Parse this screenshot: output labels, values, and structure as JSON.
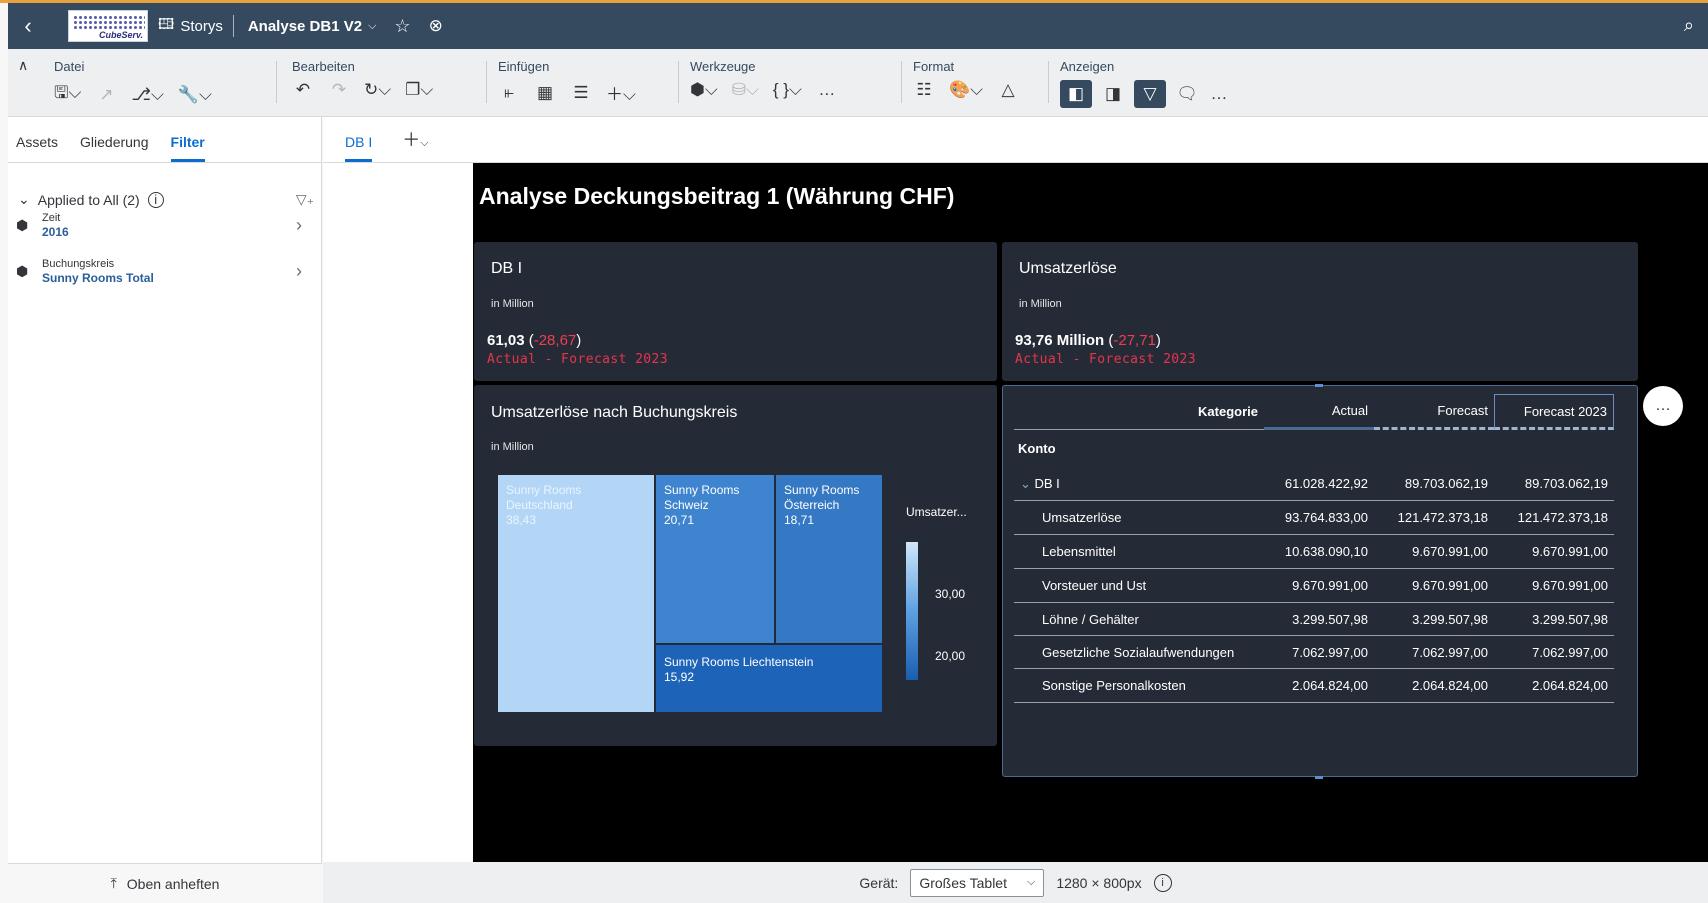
{
  "shell": {
    "logo_text": "CubeServ.",
    "storys_label": "Storys",
    "doc_title": "Analyse DB1 V2"
  },
  "toolbar": {
    "datei": "Datei",
    "bearbeiten": "Bearbeiten",
    "einfuegen": "Einfügen",
    "werkzeuge": "Werkzeuge",
    "format": "Format",
    "anzeigen": "Anzeigen"
  },
  "left": {
    "tabs": [
      "Assets",
      "Gliederung",
      "Filter"
    ],
    "applied": "Applied to All (2)",
    "filters": [
      {
        "label": "Zeit",
        "value": "2016"
      },
      {
        "label": "Buchungskreis",
        "value": "Sunny Rooms Total"
      }
    ],
    "pin_label": "Oben anheften"
  },
  "pagetabs": {
    "tab1": "DB I"
  },
  "story": {
    "title": "Analyse Deckungsbeitrag 1 (Währung CHF)",
    "kpi1": {
      "title": "DB I",
      "subtitle": "in Million",
      "value": "61,03",
      "delta_open": " (",
      "delta": "-28,67",
      "delta_close": ")",
      "label": "Actual - Forecast 2023"
    },
    "kpi2": {
      "title": "Umsatzerlöse",
      "subtitle": "in Million",
      "value": "93,76 Million",
      "delta_open": " (",
      "delta": "-27,71",
      "delta_close": ")",
      "label": "Actual - Forecast 2023"
    },
    "treemap_card": {
      "title": "Umsatzerlöse nach Buchungskreis",
      "subtitle": "in Million",
      "legend_title": "Umsatzer...",
      "legend_ticks": [
        "30,00",
        "20,00"
      ]
    },
    "table": {
      "headers": [
        "Kategorie",
        "Actual",
        "Forecast",
        "Forecast 2023"
      ],
      "section": "Konto",
      "rows": [
        {
          "label": "DB I",
          "actual": "61.028.422,92",
          "forecast": "89.703.062,19",
          "forecast2023": "89.703.062,19"
        },
        {
          "label": "Umsatzerlöse",
          "actual": "93.764.833,00",
          "forecast": "121.472.373,18",
          "forecast2023": "121.472.373,18"
        },
        {
          "label": "Lebensmittel",
          "actual": "10.638.090,10",
          "forecast": "9.670.991,00",
          "forecast2023": "9.670.991,00"
        },
        {
          "label": "Vorsteuer und Ust",
          "actual": "9.670.991,00",
          "forecast": "9.670.991,00",
          "forecast2023": "9.670.991,00"
        },
        {
          "label": "Löhne / Gehälter",
          "actual": "3.299.507,98",
          "forecast": "3.299.507,98",
          "forecast2023": "3.299.507,98"
        },
        {
          "label": "Gesetzliche Sozialaufwendungen",
          "actual": "7.062.997,00",
          "forecast": "7.062.997,00",
          "forecast2023": "7.062.997,00"
        },
        {
          "label": "Sonstige Personalkosten",
          "actual": "2.064.824,00",
          "forecast": "2.064.824,00",
          "forecast2023": "2.064.824,00"
        }
      ]
    }
  },
  "chart_data": {
    "type": "treemap",
    "title": "Umsatzerlöse nach Buchungskreis",
    "subtitle": "in Million",
    "legend_title": "Umsatzer...",
    "items": [
      {
        "name_lines": [
          "Sunny Rooms",
          "Deutschland"
        ],
        "value": 38.43,
        "value_label": "38,43",
        "color": "#b3d6f7"
      },
      {
        "name_lines": [
          "Sunny Rooms",
          "Schweiz"
        ],
        "value": 20.71,
        "value_label": "20,71",
        "color": "#3f84cf"
      },
      {
        "name_lines": [
          "Sunny Rooms",
          "Österreich"
        ],
        "value": 18.71,
        "value_label": "18,71",
        "color": "#3578c4"
      },
      {
        "name_lines": [
          "Sunny Rooms Liechtenstein"
        ],
        "value": 15.92,
        "value_label": "15,92",
        "color": "#1d63b8"
      }
    ]
  },
  "footer": {
    "geraet": "Gerät:",
    "device": "Großes Tablet",
    "resolution": "1280 × 800px"
  }
}
